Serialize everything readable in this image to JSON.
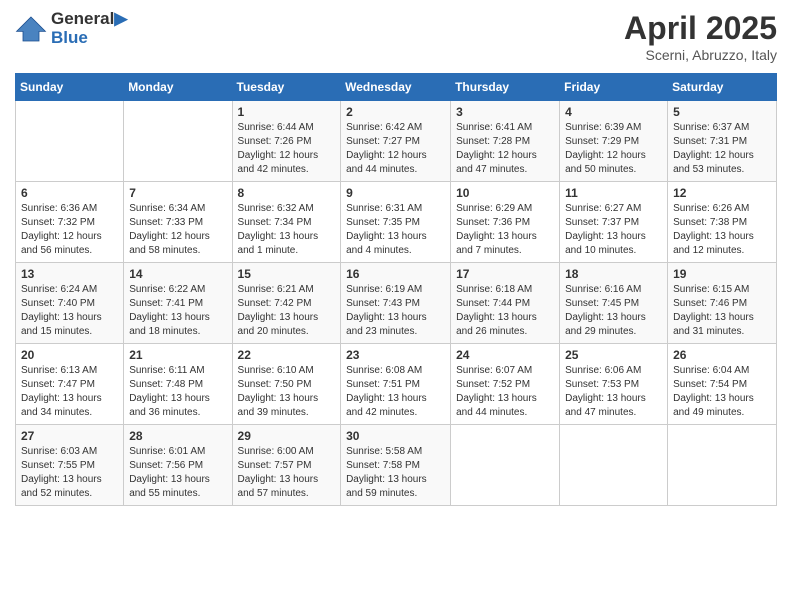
{
  "logo": {
    "line1": "General",
    "line2": "Blue"
  },
  "title": "April 2025",
  "subtitle": "Scerni, Abruzzo, Italy",
  "days_of_week": [
    "Sunday",
    "Monday",
    "Tuesday",
    "Wednesday",
    "Thursday",
    "Friday",
    "Saturday"
  ],
  "weeks": [
    [
      {
        "day": "",
        "info": ""
      },
      {
        "day": "",
        "info": ""
      },
      {
        "day": "1",
        "info": "Sunrise: 6:44 AM\nSunset: 7:26 PM\nDaylight: 12 hours and 42 minutes."
      },
      {
        "day": "2",
        "info": "Sunrise: 6:42 AM\nSunset: 7:27 PM\nDaylight: 12 hours and 44 minutes."
      },
      {
        "day": "3",
        "info": "Sunrise: 6:41 AM\nSunset: 7:28 PM\nDaylight: 12 hours and 47 minutes."
      },
      {
        "day": "4",
        "info": "Sunrise: 6:39 AM\nSunset: 7:29 PM\nDaylight: 12 hours and 50 minutes."
      },
      {
        "day": "5",
        "info": "Sunrise: 6:37 AM\nSunset: 7:31 PM\nDaylight: 12 hours and 53 minutes."
      }
    ],
    [
      {
        "day": "6",
        "info": "Sunrise: 6:36 AM\nSunset: 7:32 PM\nDaylight: 12 hours and 56 minutes."
      },
      {
        "day": "7",
        "info": "Sunrise: 6:34 AM\nSunset: 7:33 PM\nDaylight: 12 hours and 58 minutes."
      },
      {
        "day": "8",
        "info": "Sunrise: 6:32 AM\nSunset: 7:34 PM\nDaylight: 13 hours and 1 minute."
      },
      {
        "day": "9",
        "info": "Sunrise: 6:31 AM\nSunset: 7:35 PM\nDaylight: 13 hours and 4 minutes."
      },
      {
        "day": "10",
        "info": "Sunrise: 6:29 AM\nSunset: 7:36 PM\nDaylight: 13 hours and 7 minutes."
      },
      {
        "day": "11",
        "info": "Sunrise: 6:27 AM\nSunset: 7:37 PM\nDaylight: 13 hours and 10 minutes."
      },
      {
        "day": "12",
        "info": "Sunrise: 6:26 AM\nSunset: 7:38 PM\nDaylight: 13 hours and 12 minutes."
      }
    ],
    [
      {
        "day": "13",
        "info": "Sunrise: 6:24 AM\nSunset: 7:40 PM\nDaylight: 13 hours and 15 minutes."
      },
      {
        "day": "14",
        "info": "Sunrise: 6:22 AM\nSunset: 7:41 PM\nDaylight: 13 hours and 18 minutes."
      },
      {
        "day": "15",
        "info": "Sunrise: 6:21 AM\nSunset: 7:42 PM\nDaylight: 13 hours and 20 minutes."
      },
      {
        "day": "16",
        "info": "Sunrise: 6:19 AM\nSunset: 7:43 PM\nDaylight: 13 hours and 23 minutes."
      },
      {
        "day": "17",
        "info": "Sunrise: 6:18 AM\nSunset: 7:44 PM\nDaylight: 13 hours and 26 minutes."
      },
      {
        "day": "18",
        "info": "Sunrise: 6:16 AM\nSunset: 7:45 PM\nDaylight: 13 hours and 29 minutes."
      },
      {
        "day": "19",
        "info": "Sunrise: 6:15 AM\nSunset: 7:46 PM\nDaylight: 13 hours and 31 minutes."
      }
    ],
    [
      {
        "day": "20",
        "info": "Sunrise: 6:13 AM\nSunset: 7:47 PM\nDaylight: 13 hours and 34 minutes."
      },
      {
        "day": "21",
        "info": "Sunrise: 6:11 AM\nSunset: 7:48 PM\nDaylight: 13 hours and 36 minutes."
      },
      {
        "day": "22",
        "info": "Sunrise: 6:10 AM\nSunset: 7:50 PM\nDaylight: 13 hours and 39 minutes."
      },
      {
        "day": "23",
        "info": "Sunrise: 6:08 AM\nSunset: 7:51 PM\nDaylight: 13 hours and 42 minutes."
      },
      {
        "day": "24",
        "info": "Sunrise: 6:07 AM\nSunset: 7:52 PM\nDaylight: 13 hours and 44 minutes."
      },
      {
        "day": "25",
        "info": "Sunrise: 6:06 AM\nSunset: 7:53 PM\nDaylight: 13 hours and 47 minutes."
      },
      {
        "day": "26",
        "info": "Sunrise: 6:04 AM\nSunset: 7:54 PM\nDaylight: 13 hours and 49 minutes."
      }
    ],
    [
      {
        "day": "27",
        "info": "Sunrise: 6:03 AM\nSunset: 7:55 PM\nDaylight: 13 hours and 52 minutes."
      },
      {
        "day": "28",
        "info": "Sunrise: 6:01 AM\nSunset: 7:56 PM\nDaylight: 13 hours and 55 minutes."
      },
      {
        "day": "29",
        "info": "Sunrise: 6:00 AM\nSunset: 7:57 PM\nDaylight: 13 hours and 57 minutes."
      },
      {
        "day": "30",
        "info": "Sunrise: 5:58 AM\nSunset: 7:58 PM\nDaylight: 13 hours and 59 minutes."
      },
      {
        "day": "",
        "info": ""
      },
      {
        "day": "",
        "info": ""
      },
      {
        "day": "",
        "info": ""
      }
    ]
  ]
}
